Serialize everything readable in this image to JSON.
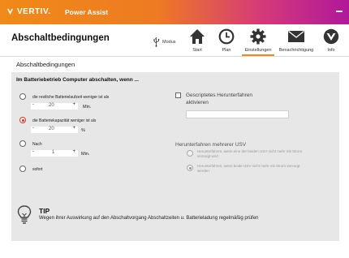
{
  "titlebar": {
    "brand": "VERTIV.",
    "app_name": "Power Assist"
  },
  "header": {
    "page_title": "Abschaltbedingungen",
    "modus_label": "Modus",
    "nav": [
      {
        "label": "Start",
        "icon": "home-icon"
      },
      {
        "label": "Plan",
        "icon": "clock-icon"
      },
      {
        "label": "Einstellungen",
        "icon": "gear-icon",
        "active": true
      },
      {
        "label": "Benachrichtigung",
        "icon": "envelope-icon"
      },
      {
        "label": "Info",
        "icon": "vertiv-logo-icon"
      }
    ]
  },
  "section_title": "Abschaltbedingungen",
  "panel": {
    "heading": "Im Batteriebetrieb Computer abschalten, wenn ...",
    "options": [
      {
        "label": "die restliche Batterielaufzeit weniger ist als",
        "value": "20",
        "unit": "Min.",
        "checked": false
      },
      {
        "label": "die Batteriekapazität weniger ist als",
        "value": "20",
        "unit": "%",
        "checked": true
      },
      {
        "label": "Nach",
        "value": "1",
        "unit": "Min.",
        "checked": false
      },
      {
        "label": "sofort",
        "checked": false
      }
    ],
    "scripted_shutdown": {
      "line1": "Gescriptetes Herunterfahren",
      "line2": "aktivieren",
      "value": ""
    },
    "multi_ups": {
      "title": "Herunterfahren mehrerer USV",
      "option1": [
        "Herunterfahren, wenn eine der beiden USV nicht mehr mit Strom",
        "versorgt wird"
      ],
      "option2": [
        "Herunterfahren, wenn beide USV nicht mehr mit Strom versorgt",
        "werden"
      ]
    },
    "tip": {
      "title": "TIP",
      "text": "Wegen ihrer Auswirkung auf den Abschaltvorgang Abschaltzeiten u. Batterieladung regelmäßig prüfen"
    }
  },
  "colors": {
    "accent": "#f08a18",
    "selected_radio": "#e0301e",
    "panel_bg": "#e7e7e7"
  }
}
